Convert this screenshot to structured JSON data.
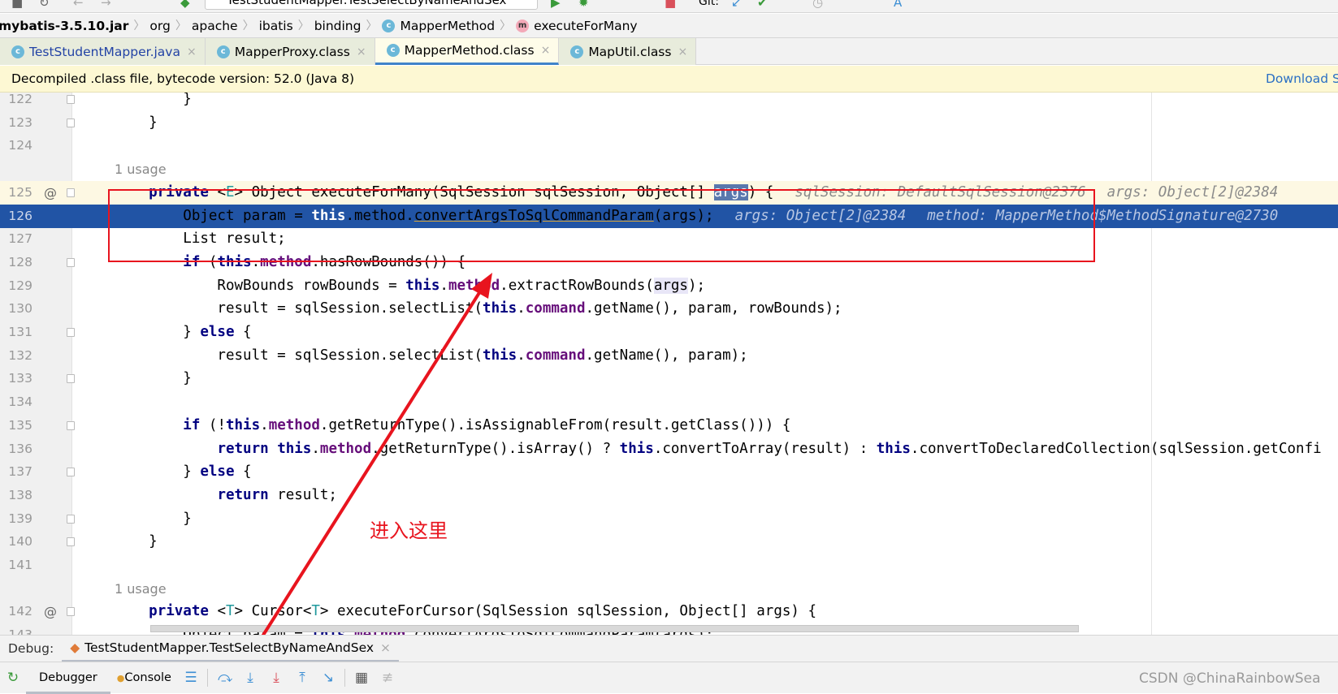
{
  "toolbar_top": {
    "run_config": "TestStudentMapper.TestSelectByNameAndSex",
    "git_label": "Git:"
  },
  "breadcrumb": {
    "items": [
      {
        "label": "mybatis-3.5.10.jar",
        "icon": ""
      },
      {
        "label": "org",
        "icon": ""
      },
      {
        "label": "apache",
        "icon": ""
      },
      {
        "label": "ibatis",
        "icon": ""
      },
      {
        "label": "binding",
        "icon": ""
      },
      {
        "label": "MapperMethod",
        "icon": "class-icon"
      },
      {
        "label": "executeForMany",
        "icon": "method-icon"
      }
    ]
  },
  "tabs": [
    {
      "label": "TestStudentMapper.java",
      "active": false
    },
    {
      "label": "MapperProxy.class",
      "active": false
    },
    {
      "label": "MapperMethod.class",
      "active": true
    },
    {
      "label": "MapUtil.class",
      "active": false
    }
  ],
  "banner": {
    "text": "Decompiled .class file, bytecode version: 52.0 (Java 8)",
    "link": "Download Sources"
  },
  "code": {
    "lines": [
      {
        "n": "122",
        "fold": true,
        "tokens": [
          {
            "t": "        }"
          }
        ]
      },
      {
        "n": "123",
        "fold": true,
        "tokens": [
          {
            "t": "    }"
          }
        ]
      },
      {
        "n": "124",
        "tokens": []
      },
      {
        "n": "",
        "usage": "1 usage"
      },
      {
        "n": "125",
        "at": "@",
        "fold": true,
        "state": "cur",
        "tokens": [
          {
            "t": "    "
          },
          {
            "t": "private",
            "c": "kw"
          },
          {
            "t": " <"
          },
          {
            "t": "E",
            "c": "tp"
          },
          {
            "t": "> Object executeForMany(SqlSession sqlSession, Object[] "
          },
          {
            "t": "args",
            "c": "hl"
          },
          {
            "t": ") {"
          }
        ],
        "hints": [
          "sqlSession: DefaultSqlSession@2376",
          "args: Object[2]@2384"
        ]
      },
      {
        "n": "126",
        "state": "sel",
        "tokens": [
          {
            "t": "        Object param = "
          },
          {
            "t": "this",
            "c": "kw"
          },
          {
            "t": ".method."
          },
          {
            "t": "convertArgsToSqlCommandParam",
            "c": "lnk"
          },
          {
            "t": "(args);"
          }
        ],
        "hints": [
          "args: Object[2]@2384",
          "method: MapperMethod$MethodSignature@2730"
        ]
      },
      {
        "n": "127",
        "tokens": [
          {
            "t": "        List result;"
          }
        ]
      },
      {
        "n": "128",
        "fold": true,
        "tokens": [
          {
            "t": "        "
          },
          {
            "t": "if",
            "c": "kw"
          },
          {
            "t": " ("
          },
          {
            "t": "this",
            "c": "kw"
          },
          {
            "t": "."
          },
          {
            "t": "method",
            "c": "fld"
          },
          {
            "t": ".hasRowBounds()) {"
          }
        ]
      },
      {
        "n": "129",
        "tokens": [
          {
            "t": "            RowBounds rowBounds = "
          },
          {
            "t": "this",
            "c": "kw"
          },
          {
            "t": "."
          },
          {
            "t": "method",
            "c": "fld"
          },
          {
            "t": ".extractRowBounds("
          },
          {
            "t": "args",
            "c": "ref"
          },
          {
            "t": ");"
          }
        ]
      },
      {
        "n": "130",
        "tokens": [
          {
            "t": "            result = sqlSession.selectList("
          },
          {
            "t": "this",
            "c": "kw"
          },
          {
            "t": "."
          },
          {
            "t": "command",
            "c": "fld"
          },
          {
            "t": ".getName(), param, rowBounds);"
          }
        ]
      },
      {
        "n": "131",
        "fold": true,
        "tokens": [
          {
            "t": "        } "
          },
          {
            "t": "else",
            "c": "kw"
          },
          {
            "t": " {"
          }
        ]
      },
      {
        "n": "132",
        "tokens": [
          {
            "t": "            result = sqlSession.selectList("
          },
          {
            "t": "this",
            "c": "kw"
          },
          {
            "t": "."
          },
          {
            "t": "command",
            "c": "fld"
          },
          {
            "t": ".getName(), param);"
          }
        ]
      },
      {
        "n": "133",
        "fold": true,
        "tokens": [
          {
            "t": "        }"
          }
        ]
      },
      {
        "n": "134",
        "tokens": []
      },
      {
        "n": "135",
        "fold": true,
        "tokens": [
          {
            "t": "        "
          },
          {
            "t": "if",
            "c": "kw"
          },
          {
            "t": " (!"
          },
          {
            "t": "this",
            "c": "kw"
          },
          {
            "t": "."
          },
          {
            "t": "method",
            "c": "fld"
          },
          {
            "t": ".getReturnType().isAssignableFrom(result.getClass())) {"
          }
        ]
      },
      {
        "n": "136",
        "tokens": [
          {
            "t": "            "
          },
          {
            "t": "return",
            "c": "kw"
          },
          {
            "t": " "
          },
          {
            "t": "this",
            "c": "kw"
          },
          {
            "t": "."
          },
          {
            "t": "method",
            "c": "fld"
          },
          {
            "t": ".getReturnType().isArray() ? "
          },
          {
            "t": "this",
            "c": "kw"
          },
          {
            "t": ".convertToArray(result) : "
          },
          {
            "t": "this",
            "c": "kw"
          },
          {
            "t": ".convertToDeclaredCollection(sqlSession.getConfi"
          }
        ]
      },
      {
        "n": "137",
        "fold": true,
        "tokens": [
          {
            "t": "        } "
          },
          {
            "t": "else",
            "c": "kw"
          },
          {
            "t": " {"
          }
        ]
      },
      {
        "n": "138",
        "tokens": [
          {
            "t": "            "
          },
          {
            "t": "return",
            "c": "kw"
          },
          {
            "t": " result;"
          }
        ]
      },
      {
        "n": "139",
        "fold": true,
        "tokens": [
          {
            "t": "        }"
          }
        ]
      },
      {
        "n": "140",
        "fold": true,
        "tokens": [
          {
            "t": "    }"
          }
        ]
      },
      {
        "n": "141",
        "tokens": []
      },
      {
        "n": "",
        "usage": "1 usage"
      },
      {
        "n": "142",
        "at": "@",
        "fold": true,
        "tokens": [
          {
            "t": "    "
          },
          {
            "t": "private",
            "c": "kw"
          },
          {
            "t": " <"
          },
          {
            "t": "T",
            "c": "tp"
          },
          {
            "t": "> Cursor<"
          },
          {
            "t": "T",
            "c": "tp"
          },
          {
            "t": "> executeForCursor(SqlSession sqlSession, Object[] args) {"
          }
        ]
      },
      {
        "n": "143",
        "tokens": [
          {
            "t": "        Object param = "
          },
          {
            "t": "this",
            "c": "kw"
          },
          {
            "t": "."
          },
          {
            "t": "method",
            "c": "fld"
          },
          {
            "t": ".convertArgsToSqlCommandParam(args);"
          }
        ]
      }
    ]
  },
  "annotation": {
    "text": "进入这里",
    "color": "#e8141e"
  },
  "debug": {
    "label": "Debug:",
    "session": "TestStudentMapper.TestSelectByNameAndSex"
  },
  "debug_toolbar": {
    "debugger": "Debugger",
    "console": "Console"
  },
  "watermark": "CSDN @ChinaRainbowSea"
}
